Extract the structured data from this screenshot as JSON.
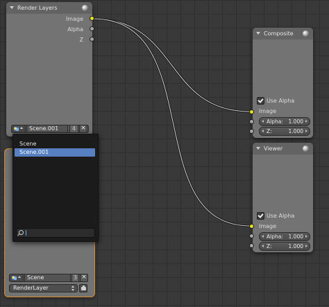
{
  "colors": {
    "canvas": "#393939",
    "node_body": "#737373",
    "node_header": "#636363",
    "image_socket": "#e8e020",
    "value_socket": "#a6a6a6",
    "selection": "#5680c2",
    "dropdown_bg": "#1b1b1b"
  },
  "render_layers_node": {
    "title": "Render Layers",
    "outputs": [
      "Image",
      "Alpha",
      "Z"
    ],
    "scene_field": "Scene.001",
    "user_count": "4",
    "icons": [
      "collapse-icon",
      "sphere-icon",
      "scene-icon",
      "close-icon"
    ]
  },
  "scene_dropdown": {
    "items": [
      "Scene",
      "Scene.001"
    ],
    "selected": "Scene.001",
    "search_value": "",
    "icons": [
      "magnifier-icon"
    ]
  },
  "render_layers_node_2": {
    "scene_field": "Scene",
    "user_count": "3",
    "render_layer": "RenderLayer",
    "icons": [
      "scene-icon",
      "close-icon",
      "render-icon"
    ]
  },
  "composite_node": {
    "title": "Composite",
    "use_alpha_label": "Use Alpha",
    "use_alpha_checked": true,
    "inputs": {
      "image": "Image",
      "alpha_label": "Alpha:",
      "alpha_value": "1.000",
      "z_label": "Z:",
      "z_value": "1.000"
    }
  },
  "viewer_node": {
    "title": "Viewer",
    "use_alpha_label": "Use Alpha",
    "use_alpha_checked": true,
    "inputs": {
      "image": "Image",
      "alpha_label": "Alpha:",
      "alpha_value": "1.000",
      "z_label": "Z:",
      "z_value": "1.000"
    }
  }
}
